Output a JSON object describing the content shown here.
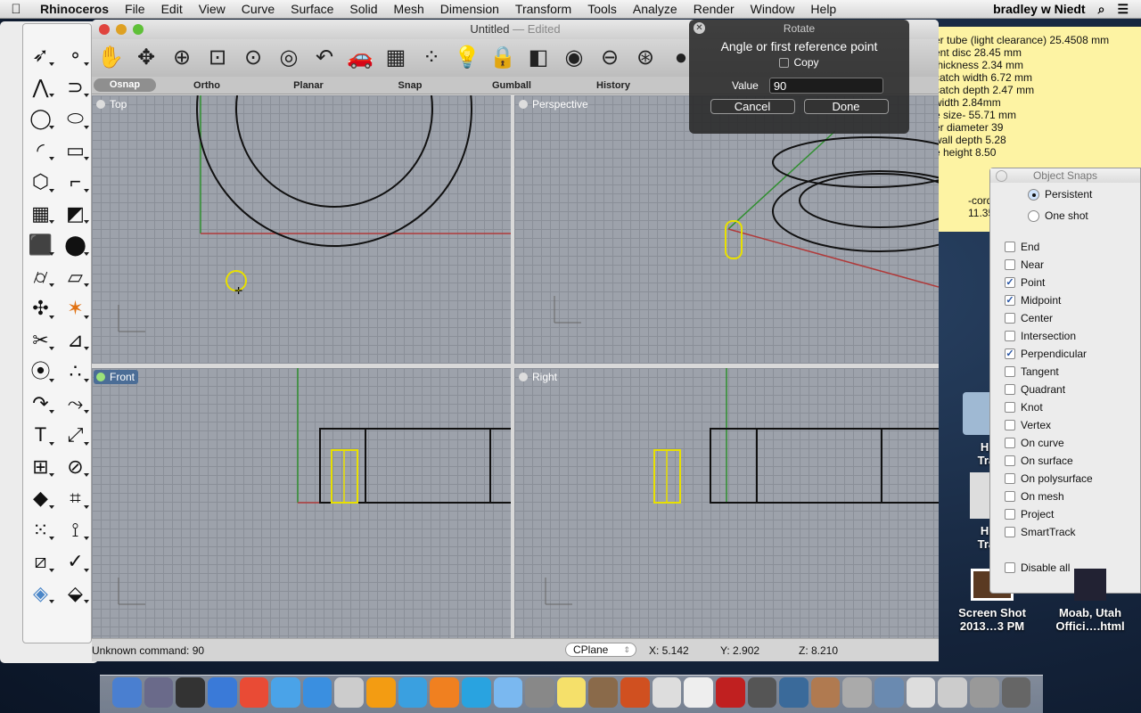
{
  "menubar": {
    "app": "Rhinoceros",
    "items": [
      "File",
      "Edit",
      "View",
      "Curve",
      "Surface",
      "Solid",
      "Mesh",
      "Dimension",
      "Transform",
      "Tools",
      "Analyze",
      "Render",
      "Window",
      "Help"
    ],
    "user": "bradley w Niedt"
  },
  "window": {
    "title": "Untitled",
    "subtitle": "— Edited"
  },
  "toolbar_icons": [
    "pan-icon",
    "rotate-view-icon",
    "zoom-icon",
    "zoom-window-icon",
    "zoom-extents-icon",
    "zoom-selected-icon",
    "undo-view-icon",
    "car-icon",
    "grid-plane-icon",
    "points-icon",
    "light-bulb-icon",
    "lock-icon",
    "layer-icon",
    "color-wheel-icon",
    "sphere-wire-icon",
    "sphere-grid-icon",
    "render-sphere-icon"
  ],
  "tabs": [
    "Osnap",
    "Ortho",
    "Planar",
    "Snap",
    "Gumball",
    "History"
  ],
  "viewports": {
    "top": "Top",
    "perspective": "Perspective",
    "front": "Front",
    "right": "Right"
  },
  "status": {
    "command": "Unknown command: 90",
    "cplane": "CPlane",
    "x": "X: 5.142",
    "y": "Y: 2.902",
    "z": "Z: 8.210"
  },
  "toolbox_icons": [
    "select-arrow-icon",
    "point-icon",
    "polyline-icon",
    "arc-curve-icon",
    "circle-icon",
    "ellipse-icon",
    "arc-icon",
    "rectangle-icon",
    "polygon-icon",
    "fillet-icon",
    "surface-icon",
    "surface-patch-icon",
    "box-icon",
    "sphere-icon",
    "cylinder-icon",
    "plane-icon",
    "puzzle-icon",
    "explode-icon",
    "trim-icon",
    "split-icon",
    "boolean-icon",
    "points-group-icon",
    "curve-edit-icon",
    "control-points-icon",
    "text-icon",
    "scale-icon",
    "array-icon",
    "analyze-icon",
    "solid-edit-icon",
    "mesh-icon",
    "grid-array-icon",
    "dimension-icon",
    "shear-icon",
    "check-icon",
    "render-icon",
    "paint-icon"
  ],
  "rotate": {
    "title": "Rotate",
    "prompt": "Angle or first reference point",
    "copy": "Copy",
    "value_label": "Value",
    "value": "90",
    "cancel": "Cancel",
    "done": "Done"
  },
  "sticky": {
    "lines": [
      "er tube (light clearance) 25.4508 mm",
      "ent disc 28.45 mm",
      "thickness 2.34 mm",
      "catch width 6.72 mm",
      "catch depth 2.47 mm",
      "width 2.84mm",
      "e size- 55.71 mm",
      "er diameter 39",
      "wall depth 5.28",
      "e height 8.50"
    ],
    "below": [
      "-cord",
      "11.35"
    ]
  },
  "osnap": {
    "title": "Object Snaps",
    "modes": [
      {
        "label": "Persistent",
        "on": true
      },
      {
        "label": "One shot",
        "on": false
      }
    ],
    "snaps": [
      {
        "label": "End",
        "on": false
      },
      {
        "label": "Near",
        "on": false
      },
      {
        "label": "Point",
        "on": true
      },
      {
        "label": "Midpoint",
        "on": true
      },
      {
        "label": "Center",
        "on": false
      },
      {
        "label": "Intersection",
        "on": false
      },
      {
        "label": "Perpendicular",
        "on": true
      },
      {
        "label": "Tangent",
        "on": false
      },
      {
        "label": "Quadrant",
        "on": false
      },
      {
        "label": "Knot",
        "on": false
      },
      {
        "label": "Vertex",
        "on": false
      },
      {
        "label": "On curve",
        "on": false
      },
      {
        "label": "On surface",
        "on": false
      },
      {
        "label": "On polysurface",
        "on": false
      },
      {
        "label": "On mesh",
        "on": false
      },
      {
        "label": "Project",
        "on": false
      },
      {
        "label": "SmartTrack",
        "on": false
      }
    ],
    "disable_all": "Disable all"
  },
  "desktop": {
    "icons": [
      [
        "Hik",
        "Trail"
      ],
      [
        "Hik",
        "Trail"
      ],
      [
        "Screen Shot",
        "2013…3 PM"
      ],
      [
        "Moab, Utah",
        "Offici….html"
      ]
    ]
  },
  "colors": {
    "curve": "#111111",
    "selected": "#e8e000",
    "x_axis": "#b03a3a",
    "y_axis": "#2f8f2f",
    "viewport_bg": "#9da2ab"
  }
}
